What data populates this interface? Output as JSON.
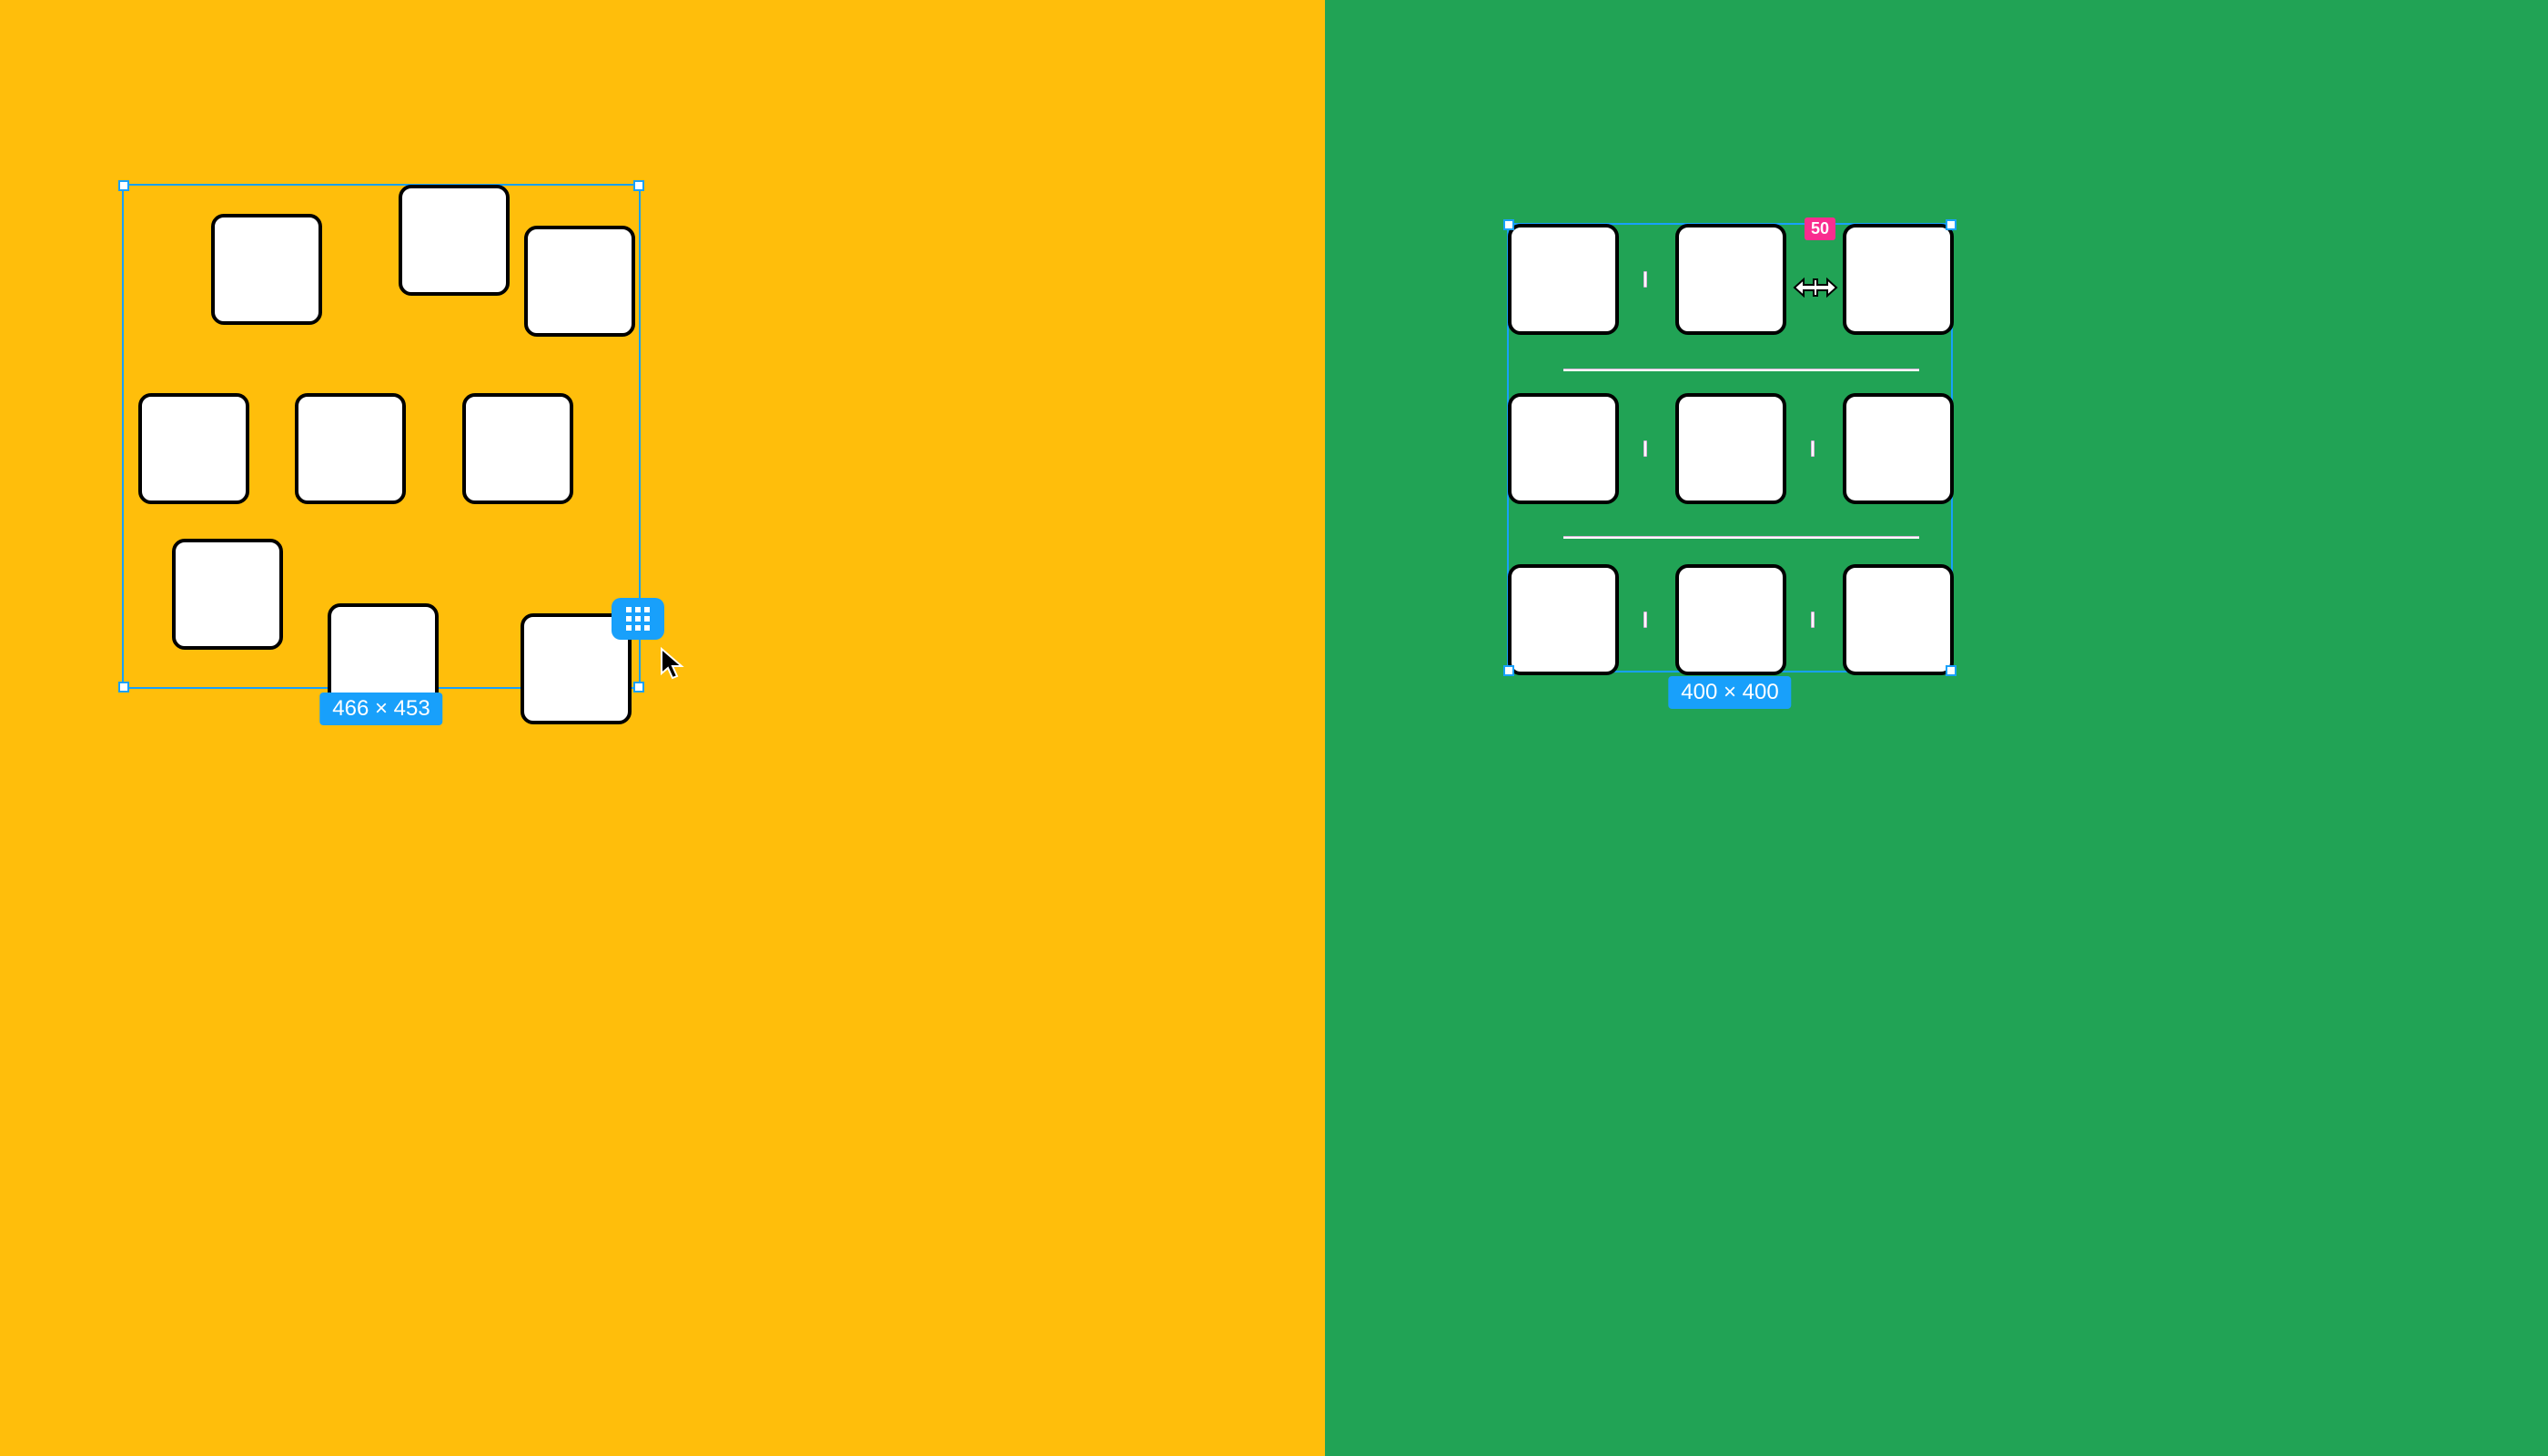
{
  "colors": {
    "accent": "#18A0FB",
    "leftBg": "#FFBE0B",
    "rightBg": "#21A355",
    "spacingBadge": "#F92D8F"
  },
  "left": {
    "dimensions": "466 × 453",
    "icon": "tidy-up-icon"
  },
  "right": {
    "dimensions": "400 × 400",
    "spacing": "50"
  }
}
